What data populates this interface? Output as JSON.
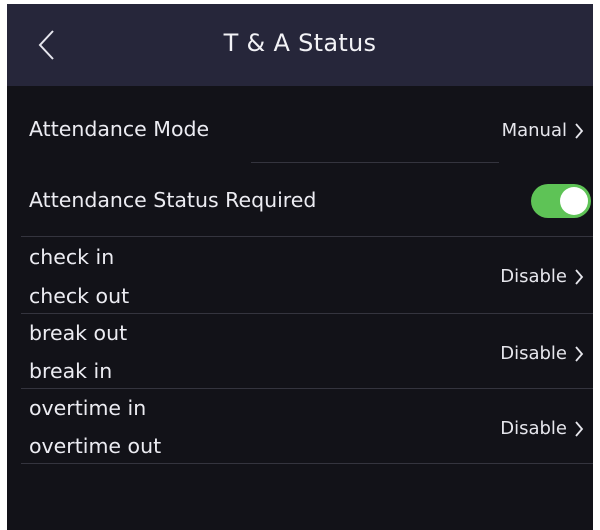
{
  "header": {
    "title": "T & A Status"
  },
  "attendance_mode": {
    "label": "Attendance Mode",
    "value": "Manual"
  },
  "status_required": {
    "label": "Attendance Status Required",
    "enabled": true
  },
  "status_pairs": [
    {
      "first": "check in",
      "second": "check out",
      "value": "Disable"
    },
    {
      "first": "break out",
      "second": "break in",
      "value": "Disable"
    },
    {
      "first": "overtime in",
      "second": "overtime out",
      "value": "Disable"
    }
  ],
  "colors": {
    "background": "#121218",
    "header": "#26263a",
    "toggle_on": "#5ec356"
  }
}
